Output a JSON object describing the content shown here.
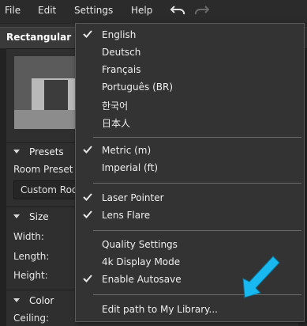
{
  "menubar": {
    "items": [
      {
        "label": "File"
      },
      {
        "label": "Edit"
      },
      {
        "label": "Settings"
      },
      {
        "label": "Help"
      }
    ],
    "undo_icon": "undo-icon",
    "redo_icon": "redo-icon"
  },
  "panel": {
    "title": "Rectangular Ro",
    "sections": [
      {
        "label": "Presets"
      },
      {
        "label": "Size"
      },
      {
        "label": "Color"
      }
    ],
    "room_preset_label": "Room Preset",
    "room_preset_value": "Custom Roo",
    "width_label": "Width:",
    "length_label": "Length:",
    "height_label": "Height:",
    "ceiling_label": "Ceiling:"
  },
  "settings_menu": {
    "languages": [
      {
        "label": "English",
        "checked": true
      },
      {
        "label": "Deutsch",
        "checked": false
      },
      {
        "label": "Français",
        "checked": false
      },
      {
        "label": "Português (BR)",
        "checked": false
      },
      {
        "label": "한국어",
        "checked": false
      },
      {
        "label": "日本人",
        "checked": false
      }
    ],
    "units": [
      {
        "label": "Metric (m)",
        "checked": true
      },
      {
        "label": "Imperial (ft)",
        "checked": false
      }
    ],
    "effects": [
      {
        "label": "Laser Pointer",
        "checked": true
      },
      {
        "label": "Lens Flare",
        "checked": true
      }
    ],
    "options": [
      {
        "label": "Quality Settings",
        "checked": false
      },
      {
        "label": "4k Display Mode",
        "checked": false
      },
      {
        "label": "Enable Autosave",
        "checked": true
      }
    ],
    "library": {
      "label": "Edit path to My Library..."
    }
  },
  "colors": {
    "accent_arrow": "#18b8f0",
    "menu_bg": "#333333"
  }
}
